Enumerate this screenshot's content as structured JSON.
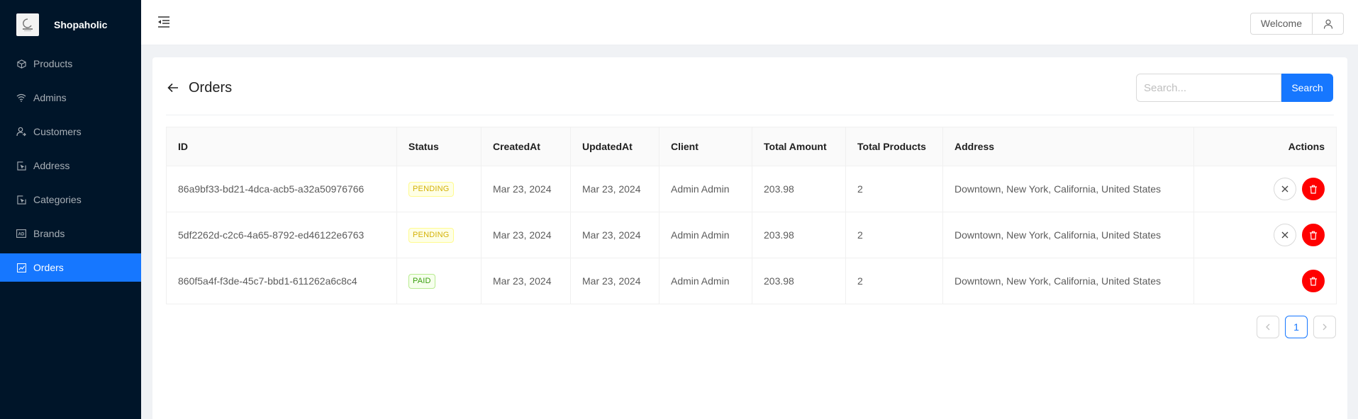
{
  "app": {
    "name": "Shopaholic"
  },
  "sidebar": {
    "items": [
      {
        "label": "Products",
        "icon": "cube-icon",
        "active": false
      },
      {
        "label": "Admins",
        "icon": "wifi-icon",
        "active": false
      },
      {
        "label": "Customers",
        "icon": "user-switch-icon",
        "active": false
      },
      {
        "label": "Address",
        "icon": "select-arrow-icon",
        "active": false
      },
      {
        "label": "Categories",
        "icon": "select-arrow-icon",
        "active": false
      },
      {
        "label": "Brands",
        "icon": "ad-icon",
        "active": false
      },
      {
        "label": "Orders",
        "icon": "line-chart-icon",
        "active": true
      }
    ]
  },
  "header": {
    "welcome_label": "Welcome"
  },
  "page": {
    "title": "Orders",
    "search": {
      "placeholder": "Search...",
      "value": "",
      "button_label": "Search"
    }
  },
  "table": {
    "columns": [
      "ID",
      "Status",
      "CreatedAt",
      "UpdatedAt",
      "Client",
      "Total Amount",
      "Total Products",
      "Address",
      "Actions"
    ],
    "rows": [
      {
        "id": "86a9bf33-bd21-4dca-acb5-a32a50976766",
        "status": "PENDING",
        "created_at": "Mar 23, 2024",
        "updated_at": "Mar 23, 2024",
        "client": "Admin Admin",
        "total_amount": "203.98",
        "total_products": "2",
        "address": "Downtown, New York, California, United States"
      },
      {
        "id": "5df2262d-c2c6-4a65-8792-ed46122e6763",
        "status": "PENDING",
        "created_at": "Mar 23, 2024",
        "updated_at": "Mar 23, 2024",
        "client": "Admin Admin",
        "total_amount": "203.98",
        "total_products": "2",
        "address": "Downtown, New York, California, United States"
      },
      {
        "id": "860f5a4f-f3de-45c7-bbd1-611262a6c8c4",
        "status": "PAID",
        "created_at": "Mar 23, 2024",
        "updated_at": "Mar 23, 2024",
        "client": "Admin Admin",
        "total_amount": "203.98",
        "total_products": "2",
        "address": "Downtown, New York, California, United States"
      }
    ]
  },
  "pagination": {
    "current_page": "1"
  },
  "colors": {
    "sidebar_bg": "#001529",
    "accent": "#1677ff",
    "danger": "#ff0000",
    "pending": "#d4b106",
    "paid": "#389e0d"
  }
}
